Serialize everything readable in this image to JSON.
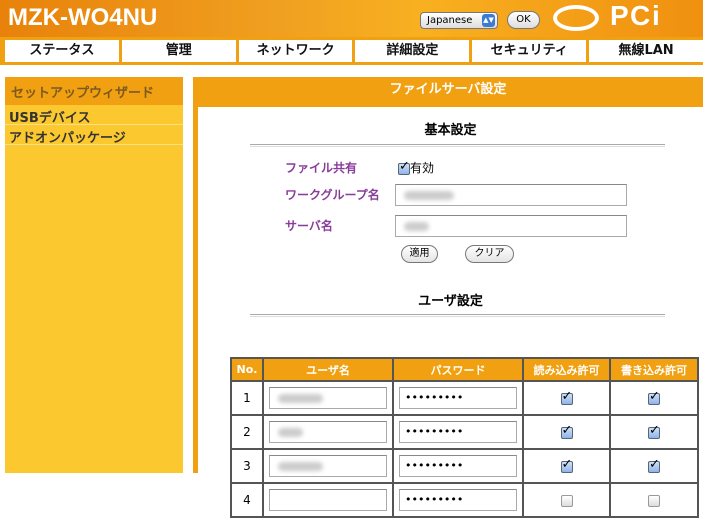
{
  "header": {
    "title": "MZK-WO4NU",
    "language": "Japanese",
    "ok_label": "OK",
    "logo": "PCi"
  },
  "nav": [
    "ステータス",
    "管理",
    "ネットワーク",
    "詳細設定",
    "セキュリティ",
    "無線LAN"
  ],
  "sidebar": {
    "heading": "セットアップウィザード",
    "items": [
      "USBデバイス",
      "アドオンパッケージ"
    ]
  },
  "main": {
    "title": "ファイルサーバ設定",
    "basic": {
      "heading": "基本設定",
      "file_share_label": "ファイル共有",
      "file_share_enabled": true,
      "file_share_value": "有効",
      "workgroup_label": "ワークグループ名",
      "server_label": "サーバ名",
      "apply": "適用",
      "clear": "クリア"
    },
    "users": {
      "heading": "ユーザ設定",
      "columns": [
        "No.",
        "ユーザ名",
        "パスワード",
        "読み込み許可",
        "書き込み許可"
      ],
      "rows": [
        {
          "no": "1",
          "password": "•••••••••",
          "read": true,
          "write": true
        },
        {
          "no": "2",
          "password": "•••••••••",
          "read": true,
          "write": true
        },
        {
          "no": "3",
          "password": "•••••••••",
          "read": true,
          "write": true
        },
        {
          "no": "4",
          "password": "•••••••••",
          "read": false,
          "write": false
        }
      ]
    }
  }
}
